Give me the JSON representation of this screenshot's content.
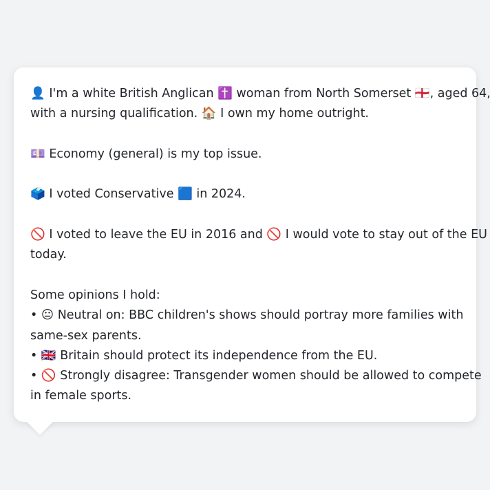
{
  "profile": {
    "lines": [
      "👤 I'm a white British Anglican ✝️ woman from North Somerset 🏴󠁧󠁢󠁥󠁮󠁧󠁿, aged 64,",
      "with a nursing qualification. 🏠 I own my home outright.",
      "",
      "💷 Economy (general) is my top issue.",
      "",
      "🗳️ I voted Conservative 🟦 in 2024.",
      "",
      "🚫 I voted to leave the EU in 2016 and 🚫 I would vote to stay out of the EU",
      "today.",
      "",
      "Some opinions I hold:",
      "• 😐 Neutral on: BBC children's shows should portray more families with",
      "same-sex parents.",
      "• 🇬🇧 Britain should protect its independence from the EU.",
      "• 🚫 Strongly disagree: Transgender women should be allowed to compete",
      "in female sports."
    ]
  }
}
